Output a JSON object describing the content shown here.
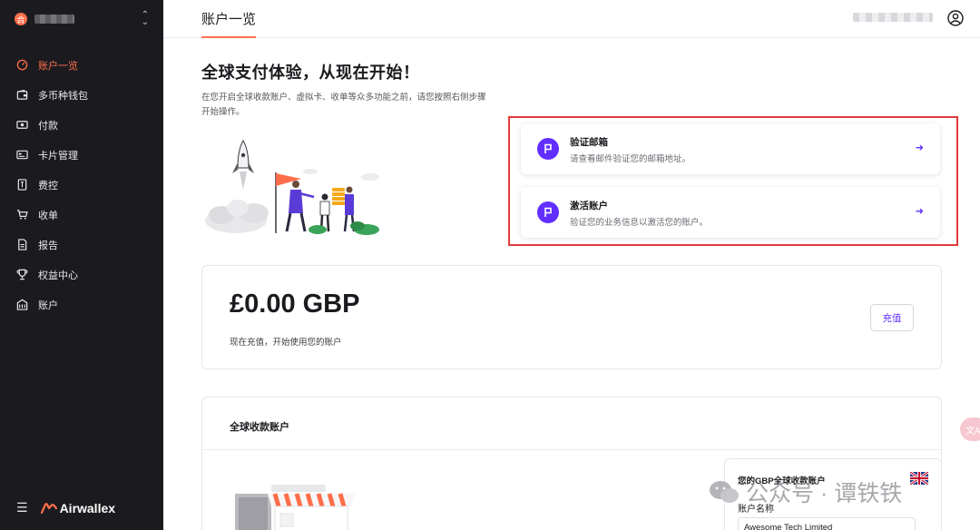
{
  "sidebar": {
    "workspace_badge": "合",
    "items": [
      {
        "label": "账户一览",
        "icon": "dashboard-icon",
        "active": true
      },
      {
        "label": "多币种钱包",
        "icon": "wallet-icon"
      },
      {
        "label": "付款",
        "icon": "payment-icon"
      },
      {
        "label": "卡片管理",
        "icon": "card-icon"
      },
      {
        "label": "费控",
        "icon": "expense-icon"
      },
      {
        "label": "收单",
        "icon": "cart-icon"
      },
      {
        "label": "报告",
        "icon": "report-icon"
      },
      {
        "label": "权益中心",
        "icon": "trophy-icon"
      },
      {
        "label": "账户",
        "icon": "building-icon"
      }
    ],
    "brand": "Airwallex"
  },
  "header": {
    "tab": "账户一览"
  },
  "hero": {
    "title": "全球支付体验，从现在开始！",
    "description": "在您开启全球收款账户、虚拟卡、收单等众多功能之前，请您按照右侧步骤开始操作。"
  },
  "tasks": [
    {
      "title": "验证邮箱",
      "description": "请查看邮件验证您的邮箱地址。"
    },
    {
      "title": "激活账户",
      "description": "验证您的业务信息以激活您的账户。"
    }
  ],
  "balance": {
    "amount": "£0.00 GBP",
    "subtitle": "现在充值，开始使用您的账户",
    "topup_label": "充值"
  },
  "accounts": {
    "title": "全球收款账户",
    "card_title": "您的GBP全球收款账户",
    "name_label": "账户名称",
    "name_value": "Awesome Tech Limited"
  },
  "translate": {
    "label": "文A"
  },
  "watermark": {
    "text": "公众号 · 谭铁铁"
  },
  "colors": {
    "accent": "#ff6e4a",
    "brand_purple": "#612fff",
    "sidebar_bg": "#1b1b1f",
    "highlight": "#e23b3b"
  }
}
